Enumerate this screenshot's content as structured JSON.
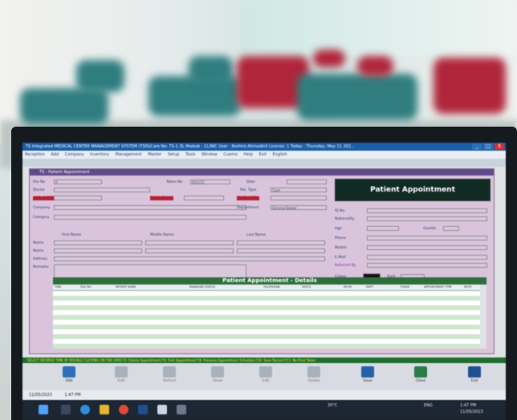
{
  "window": {
    "title": "TS Integrated MEDICAL CENTER MANAGEMENT SYSTEM (TSIS)Care No: TS-1-3L Module : CLINIC User : Koshiro Ahmadinil License: 1 Today : Thursday, May 11 202...",
    "controls": [
      "_",
      "□",
      "X"
    ]
  },
  "menu": [
    "Reception",
    "Add",
    "Company",
    "Inventory",
    "Management",
    "Master",
    "Setup",
    "Tools",
    "Window",
    "Cuemo",
    "Help",
    "Exit",
    "English"
  ],
  "form": {
    "header": "TS - Patient Appointment",
    "title": "Patient Appointment",
    "labels": {
      "file_no": "File No",
      "doctor": "Doctor",
      "appt_date": "APP. DATE",
      "company": "Company",
      "category": "Category",
      "token_no": "Token No",
      "time_from": "TIME FROM",
      "date": "Date",
      "pat_type": "Pat. Type",
      "time_upto": "TIME UPTO",
      "department": "Department",
      "name": "Name",
      "name_ar": "Name",
      "address": "Address",
      "remarks": "Remarks",
      "first_name": "First Name",
      "middle_name": "Middle Name",
      "last_name": "Last Name",
      "id_no": "ID No",
      "nationality": "Nationality",
      "age": "Age",
      "gender": "Gender",
      "phone": "Phone",
      "mobile": "Mobile",
      "email": "E-Mail",
      "referred_by": "Referred By",
      "colour": "Colour",
      "sorti": "Sorti"
    },
    "values": {
      "file_no": "0",
      "token_no": "0/11/11",
      "pat_type": "Cash",
      "department": "General Dental"
    }
  },
  "details": {
    "title": "Patient Appointment - Details",
    "columns": [
      "TIME",
      "FILE NO",
      "PATIENT NAME",
      "MANAGER STATUS",
      "TELEPHONE",
      "VISITS",
      "MOVE",
      "DEPT",
      "TOKEN",
      "APPOINTMENT TYPE",
      "NOTE"
    ]
  },
  "hint": "SELECT DESIRED TIME BY DOUBLE CLICKING ON THE GRID    F3: Delete Appointment    F6: Find Appointment    F8: Previous Appointment Schedule    F10: Save Record    F11: No Print Token",
  "buttons": [
    "Add",
    "Edit",
    "Vertical",
    "Show",
    "Edit",
    "Delete",
    "Save",
    "Close",
    "Exit"
  ],
  "status": {
    "date": "11/05/2023",
    "time": "1:47 PM"
  },
  "taskbar": {
    "weather": "30°C",
    "clock": "1:47 PM",
    "date": "11/05/2023",
    "lang": "ENG"
  },
  "colors": {
    "titlebar": "#1c5da6",
    "form": "#d9c4dc",
    "section_bar": "#2e6e3c",
    "title_panel": "#0f2b24"
  }
}
